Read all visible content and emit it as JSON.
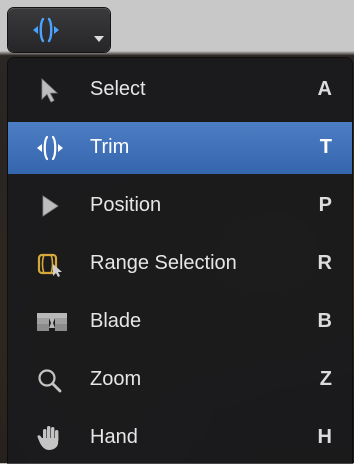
{
  "toolbar": {
    "current_tool_icon": "trim-icon",
    "dropdown_icon": "chevron-down-icon"
  },
  "menu": {
    "items": [
      {
        "label": "Select",
        "shortcut": "A",
        "icon": "arrow-pointer-icon",
        "selected": false
      },
      {
        "label": "Trim",
        "shortcut": "T",
        "icon": "trim-icon",
        "selected": true
      },
      {
        "label": "Position",
        "shortcut": "P",
        "icon": "position-arrow-icon",
        "selected": false
      },
      {
        "label": "Range Selection",
        "shortcut": "R",
        "icon": "range-selection-icon",
        "selected": false
      },
      {
        "label": "Blade",
        "shortcut": "B",
        "icon": "blade-icon",
        "selected": false
      },
      {
        "label": "Zoom",
        "shortcut": "Z",
        "icon": "zoom-icon",
        "selected": false
      },
      {
        "label": "Hand",
        "shortcut": "H",
        "icon": "hand-icon",
        "selected": false
      }
    ]
  },
  "colors": {
    "selection": "#3d6fb6",
    "accent_icon": "#4aa3ff",
    "range_icon": "#d7a93a",
    "menu_background": "#1a1a1c"
  }
}
